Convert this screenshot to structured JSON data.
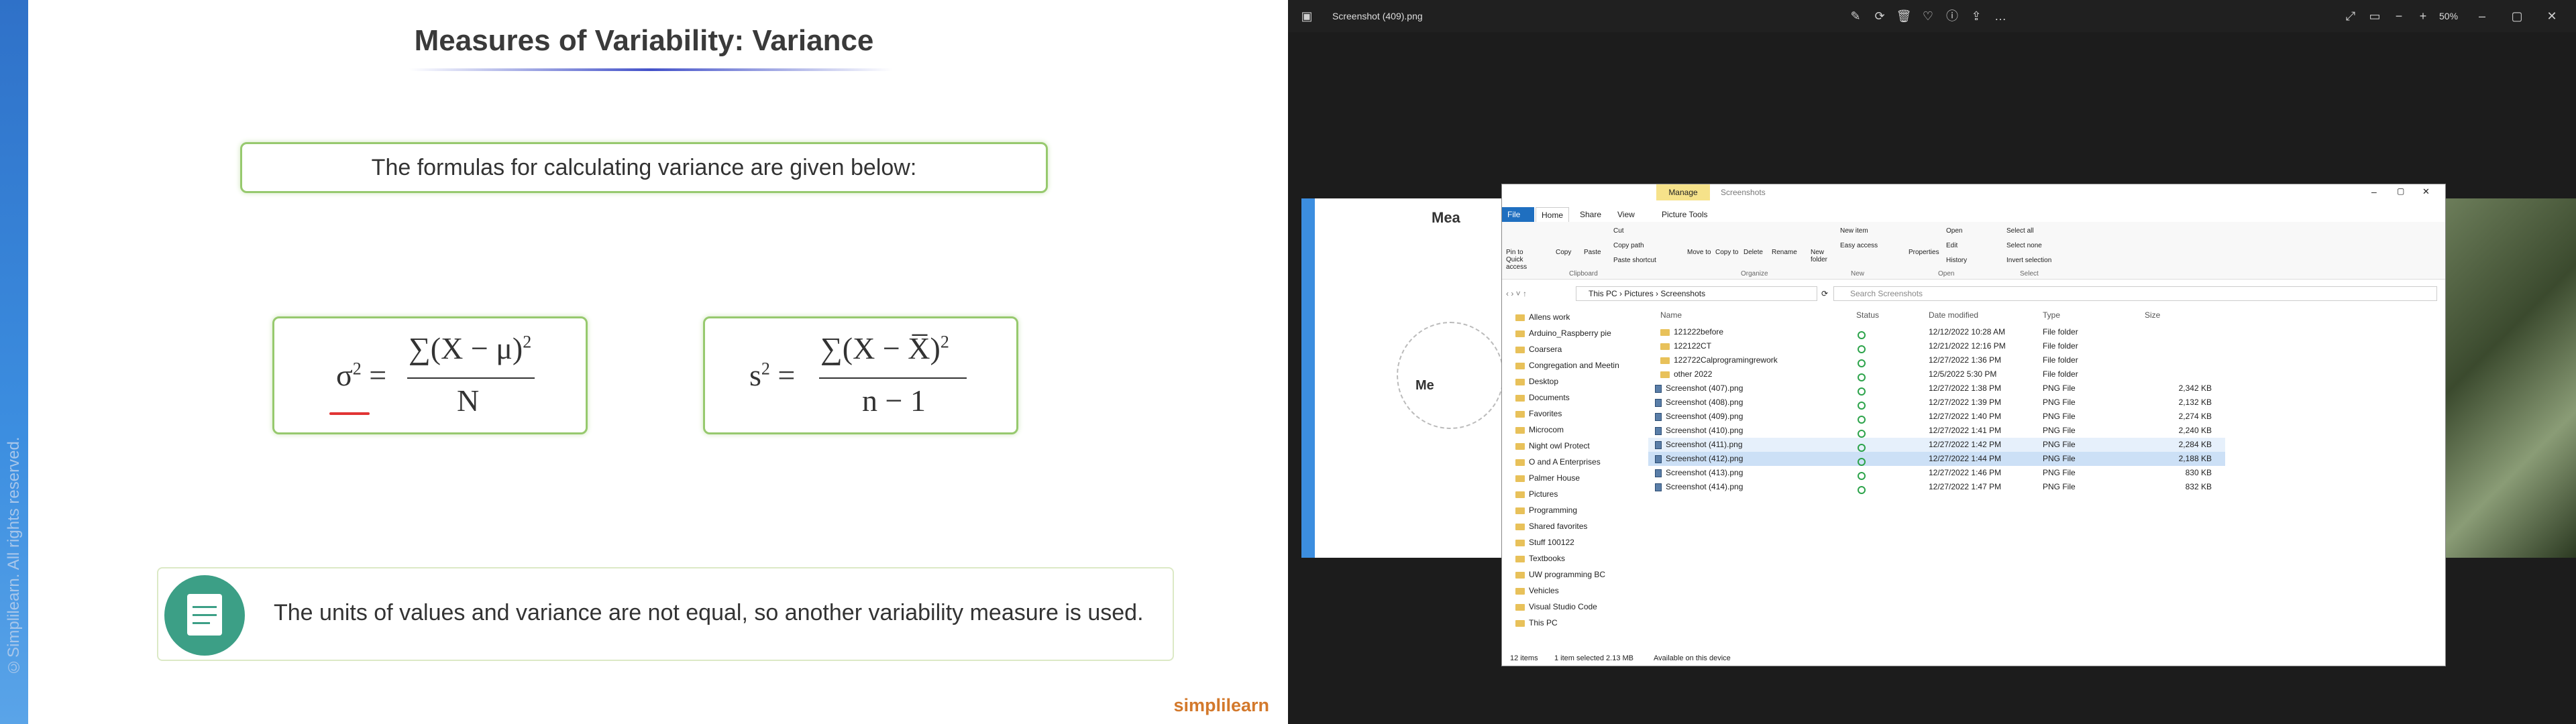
{
  "slide": {
    "title": "Measures of Variability: Variance",
    "intro": "The formulas for calculating variance are given below:",
    "note": "The units of values and variance are not equal, so another variability measure is used.",
    "watermark": "©Simplilearn. All rights reserved.",
    "brand": "simplilearn",
    "accent": "#3c8ee0"
  },
  "formulas": {
    "pop_lhs": "σ",
    "pop_exp": "2",
    "pop_num": "∑(X − μ)",
    "pop_num_exp": "2",
    "pop_den": "N",
    "sample_lhs": "s",
    "sample_exp": "2",
    "sample_num": "∑(X − X̅)",
    "sample_num_exp": "2",
    "sample_den": "n − 1",
    "eq": "="
  },
  "viewer": {
    "filename": "Screenshot (409).png",
    "zoom": "50%",
    "bg_slide_title": "Mea",
    "bg_slide_me": "Me"
  },
  "explorer": {
    "title": "Screenshots",
    "manage": "Manage",
    "tabs": [
      "File",
      "Home",
      "Share",
      "View",
      "Picture Tools"
    ],
    "ribbon": {
      "clipboard": [
        "Pin to Quick access",
        "Copy",
        "Paste",
        "Cut",
        "Copy path",
        "Paste shortcut"
      ],
      "organize": [
        "Move to",
        "Copy to",
        "Delete",
        "Rename"
      ],
      "new": [
        "New folder",
        "New item",
        "Easy access"
      ],
      "open": [
        "Properties",
        "Open",
        "Edit",
        "History"
      ],
      "select": [
        "Select all",
        "Select none",
        "Invert selection"
      ],
      "groups": [
        "Clipboard",
        "Organize",
        "New",
        "Open",
        "Select"
      ]
    },
    "path": [
      "This PC",
      "Pictures",
      "Screenshots"
    ],
    "search": "Search Screenshots",
    "nav": [
      "Allens work",
      "Arduino_Raspberry pie",
      "Coarsera",
      "Congregation and Meetin",
      "Desktop",
      "Documents",
      "Favorites",
      "Microcom",
      "Night owl Protect",
      "O and A Enterprises",
      "Palmer House",
      "Pictures",
      "Programming",
      "Shared favorites",
      "Stuff 100122",
      "Textbooks",
      "UW programming BC",
      "Vehicles",
      "Visual Studio Code",
      "This PC"
    ],
    "columns": [
      "Name",
      "Status",
      "Date modified",
      "Type",
      "Size"
    ],
    "files": [
      {
        "name": "121222before",
        "date": "12/12/2022 10:28 AM",
        "type": "File folder",
        "size": ""
      },
      {
        "name": "122122CT",
        "date": "12/21/2022 12:16 PM",
        "type": "File folder",
        "size": ""
      },
      {
        "name": "122722Calprogramingrework",
        "date": "12/27/2022 1:36 PM",
        "type": "File folder",
        "size": ""
      },
      {
        "name": "other 2022",
        "date": "12/5/2022 5:30 PM",
        "type": "File folder",
        "size": ""
      },
      {
        "name": "Screenshot (407).png",
        "date": "12/27/2022 1:38 PM",
        "type": "PNG File",
        "size": "2,342 KB"
      },
      {
        "name": "Screenshot (408).png",
        "date": "12/27/2022 1:39 PM",
        "type": "PNG File",
        "size": "2,132 KB"
      },
      {
        "name": "Screenshot (409).png",
        "date": "12/27/2022 1:40 PM",
        "type": "PNG File",
        "size": "2,274 KB"
      },
      {
        "name": "Screenshot (410).png",
        "date": "12/27/2022 1:41 PM",
        "type": "PNG File",
        "size": "2,240 KB"
      },
      {
        "name": "Screenshot (411).png",
        "date": "12/27/2022 1:42 PM",
        "type": "PNG File",
        "size": "2,284 KB"
      },
      {
        "name": "Screenshot (412).png",
        "date": "12/27/2022 1:44 PM",
        "type": "PNG File",
        "size": "2,188 KB"
      },
      {
        "name": "Screenshot (413).png",
        "date": "12/27/2022 1:46 PM",
        "type": "PNG File",
        "size": "830 KB"
      },
      {
        "name": "Screenshot (414).png",
        "date": "12/27/2022 1:47 PM",
        "type": "PNG File",
        "size": "832 KB"
      }
    ],
    "status": [
      "12 items",
      "1 item selected  2.13 MB",
      "Available on this device"
    ]
  }
}
